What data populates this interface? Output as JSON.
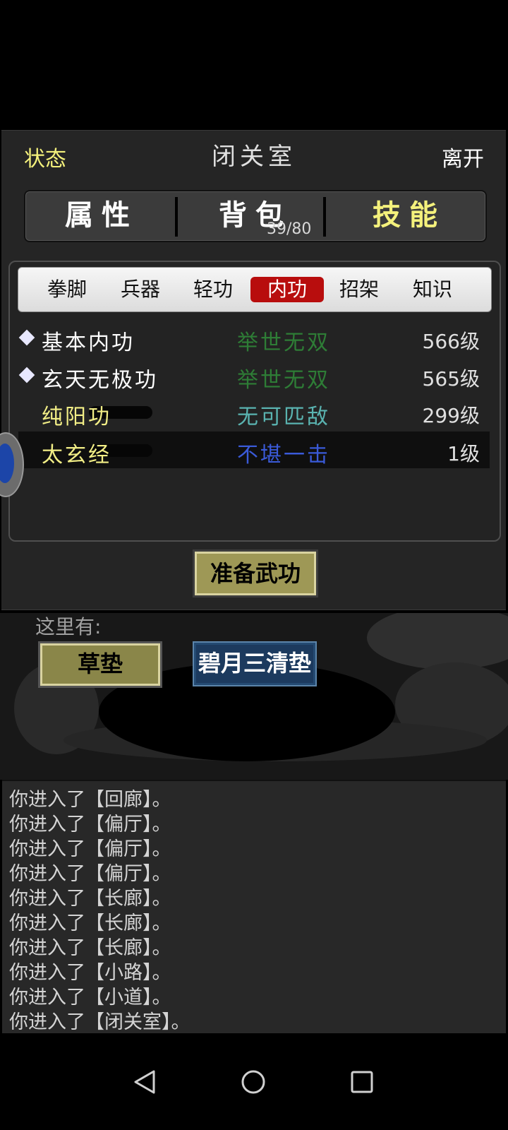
{
  "header": {
    "status": "状态",
    "room": "闭关室",
    "leave": "离开"
  },
  "main_tabs": {
    "attributes": "属性",
    "bag": "背包",
    "bag_count": "39/80",
    "skills": "技能",
    "active": "技能"
  },
  "sub_tabs": [
    "拳脚",
    "兵器",
    "轻功",
    "内功",
    "招架",
    "知识"
  ],
  "active_sub_tab": "内功",
  "skills": [
    {
      "name": "基本内功",
      "rank": "举世无双",
      "level": "566级",
      "equipped": true,
      "name_color": "#ffffff",
      "rank_color": "#2e7d36"
    },
    {
      "name": "玄天无极功",
      "rank": "举世无双",
      "level": "565级",
      "equipped": true,
      "name_color": "#ffffff",
      "rank_color": "#2e7d36"
    },
    {
      "name": "纯阳功",
      "rank": "无可匹敌",
      "level": "299级",
      "equipped": false,
      "name_color": "#f2ee86",
      "rank_color": "#5ab3b0"
    },
    {
      "name": "太玄经",
      "rank": "不堪一击",
      "level": "1级",
      "equipped": false,
      "name_color": "#f2ee86",
      "rank_color": "#3a5ad8"
    }
  ],
  "prep_button": "准备武功",
  "scene": {
    "here_label": "这里有:",
    "items": [
      "草垫",
      "碧月三清垫"
    ]
  },
  "log": [
    "你进入了【回廊】。",
    "你进入了【偏厅】。",
    "你进入了【偏厅】。",
    "你进入了【偏厅】。",
    "你进入了【长廊】。",
    "你进入了【长廊】。",
    "你进入了【长廊】。",
    "你进入了【小路】。",
    "你进入了【小道】。",
    "你进入了【闭关室】。"
  ],
  "nav": {
    "back": "back-icon",
    "home": "home-icon",
    "recents": "recents-icon"
  }
}
